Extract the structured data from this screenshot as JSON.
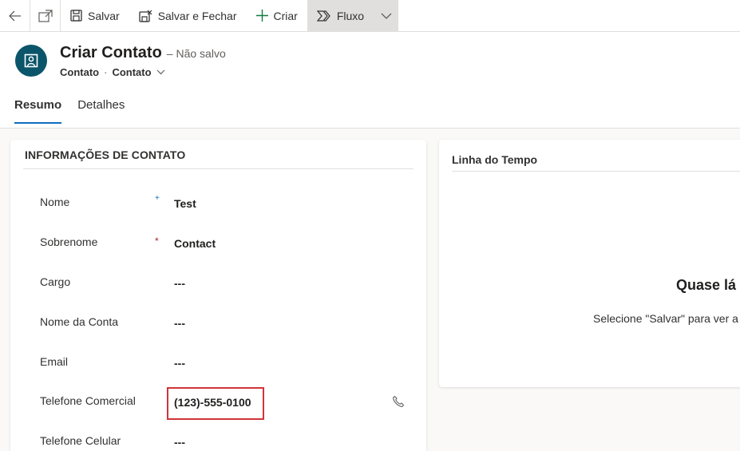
{
  "toolbar": {
    "back_icon": "back-arrow-icon",
    "popout_icon": "open-in-new-window-icon",
    "save_label": "Salvar",
    "save_close_label": "Salvar e Fechar",
    "new_label": "Criar",
    "flow_label": "Fluxo"
  },
  "header": {
    "title": "Criar Contato",
    "status": "– Não salvo",
    "entity": "Contato",
    "form_selector": "Contato",
    "avatar_color": "#0b556a"
  },
  "tabs": [
    {
      "label": "Resumo",
      "active": true
    },
    {
      "label": "Detalhes",
      "active": false
    }
  ],
  "contact_section": {
    "title": "INFORMAÇÕES DE CONTATO",
    "fields": [
      {
        "label": "Nome",
        "value": "Test",
        "marker": "+"
      },
      {
        "label": "Sobrenome",
        "value": "Contact",
        "marker": "*"
      },
      {
        "label": "Cargo",
        "value": "---"
      },
      {
        "label": "Nome da Conta",
        "value": "---"
      },
      {
        "label": "Email",
        "value": "---"
      },
      {
        "label": "Telefone Comercial",
        "value": "(123)-555-0100"
      },
      {
        "label": "Telefone Celular",
        "value": "---"
      }
    ]
  },
  "timeline": {
    "title": "Linha do Tempo",
    "heading": "Quase lá",
    "message": "Selecione \"Salvar\" para ver a li"
  },
  "colors": {
    "accent": "#0f6cbd",
    "required": "#a4262c",
    "highlight": "#d13438"
  }
}
